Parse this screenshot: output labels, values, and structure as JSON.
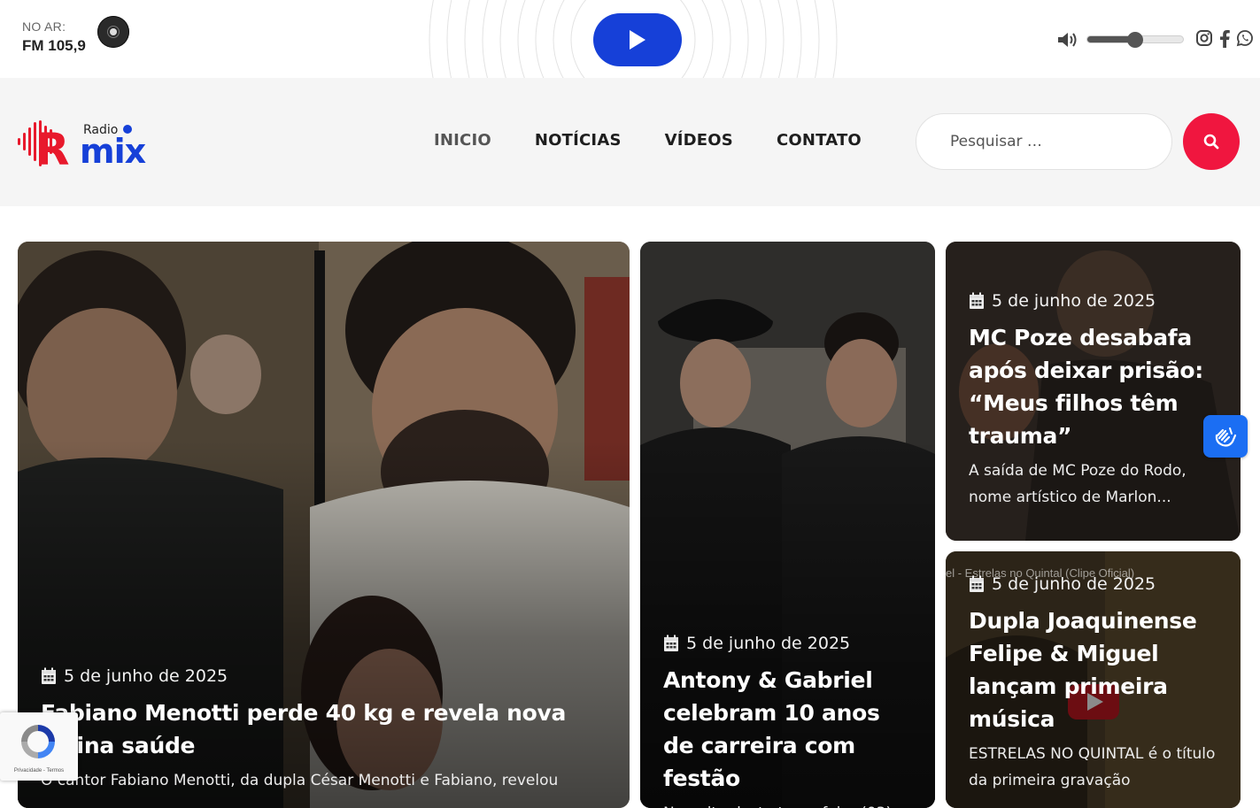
{
  "player": {
    "onair_label": "NO AR:",
    "station": "FM 105,9",
    "play_icon": "play-icon",
    "volume_icon": "volume-icon",
    "volume_level": 0.5,
    "social": [
      "instagram-icon",
      "facebook-icon",
      "whatsapp-icon"
    ]
  },
  "brand": {
    "logo_small": "Radio",
    "logo_main": "mix",
    "logo_letter": "R",
    "accent": "#e8192c",
    "blue": "#1640d8"
  },
  "nav": {
    "items": [
      {
        "label": "INICIO",
        "active": true
      },
      {
        "label": "NOTÍCIAS"
      },
      {
        "label": "VÍDEOS"
      },
      {
        "label": "CONTATO"
      }
    ]
  },
  "search": {
    "placeholder": "Pesquisar …",
    "button_color": "#f0163f"
  },
  "cards": [
    {
      "date": "5 de junho de 2025",
      "title": "Fabiano Menotti perde 40 kg e revela nova rotina saúde",
      "excerpt": "O cantor Fabiano Menotti, da dupla César Menotti e Fabiano, revelou"
    },
    {
      "date": "5 de junho de 2025",
      "title": "Antony & Gabriel celebram 10 anos de carreira com festão",
      "excerpt": "Na noite desta terça-feira (03),"
    },
    {
      "date": "5 de junho de 2025",
      "title": "MC Poze desabafa após deixar prisão: “Meus filhos têm trauma”",
      "excerpt": "A saída de MC Poze do Rodo, nome artístico de Marlon..."
    },
    {
      "date": "5 de junho de 2025",
      "title": "Dupla Joaquinense Felipe & Miguel lançam primeira música",
      "excerpt": "ESTRELAS NO QUINTAL é o título da primeira gravação",
      "video_overlay": "el - Estrelas no Quintal (Clipe Oficial)"
    }
  ],
  "widgets": {
    "accessibility_icon": "sign-language-icon",
    "recaptcha_links": "Privacidade - Termos"
  }
}
